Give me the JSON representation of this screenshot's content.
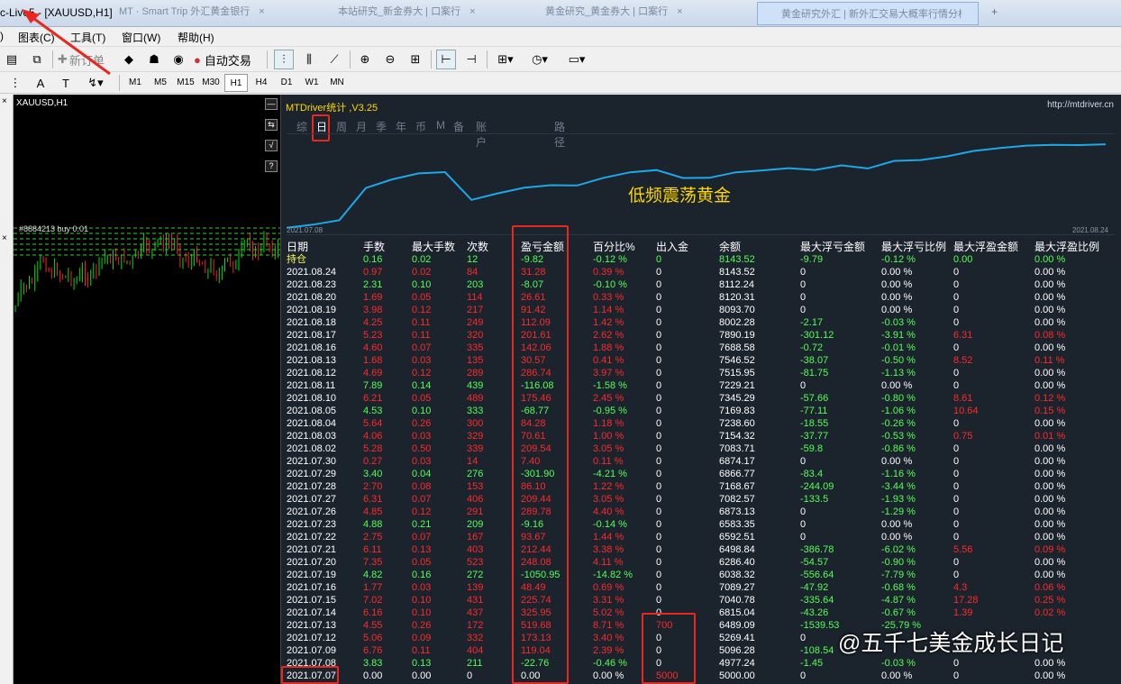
{
  "window": {
    "title": "c-Live5 - [XAUUSD,H1]",
    "tabs": [
      "MT · Smart Trip 外汇黄金银行",
      "本站研究_新金券大 | 口案行",
      "黄金研究_黄金券大 | 口案行"
    ],
    "active_tab": "黄金研究外汇 | 新外汇交易大概率行情分析",
    "new_tab": "+"
  },
  "menu": {
    "items": [
      "图表(C)",
      "工具(T)",
      "窗口(W)",
      "帮助(H)"
    ],
    "truncated_first": ")"
  },
  "toolbar": {
    "new_order": "新订单",
    "auto_trading": "自动交易",
    "text_tool": "A",
    "text_label_tool": "T"
  },
  "timeframes": [
    "M1",
    "M5",
    "M15",
    "M30",
    "H1",
    "H4",
    "D1",
    "W1",
    "MN"
  ],
  "active_timeframe": "H1",
  "chart": {
    "symbol_label": "XAUUSD,H1",
    "overlay_text": "#8884213 buy 0.01",
    "buttons": [
      "—",
      "⇆",
      "√",
      "?"
    ]
  },
  "panel": {
    "title": "MTDriver统计 ,V3.25",
    "url": "http://mtdriver.cn",
    "tabs": [
      "综",
      "日",
      "周",
      "月",
      "季",
      "年",
      "币",
      "M",
      "备",
      "账户",
      "路径"
    ],
    "selected_tab": "日",
    "graph_start": "2021.07.08",
    "graph_end": "2021.08.24",
    "graph_caption": "低频震荡黄金",
    "equity_curve": [
      4977,
      5096,
      5269,
      6489,
      6815,
      7040,
      7089,
      6038,
      6286,
      6498,
      6592,
      6583,
      6873,
      7082,
      7167,
      6866,
      6874,
      7083,
      7154,
      7238,
      7169,
      7345,
      7229,
      7515,
      7546,
      7688,
      7890,
      8002,
      8093,
      8120,
      8112,
      8143
    ]
  },
  "table": {
    "columns": [
      "日期",
      "手数",
      "最大手数",
      "次数",
      "盈亏金额",
      "百分比%",
      "出入金",
      "余额",
      "最大浮亏金额",
      "最大浮亏比例",
      "最大浮盈金额",
      "最大浮盈比例"
    ],
    "rows": [
      {
        "date": "持仓",
        "lots": "0.16",
        "max_lots": "0.02",
        "count": "12",
        "pnl": "-9.82",
        "pct": "-0.12 %",
        "io": "0",
        "balance": "8143.52",
        "mfl": "-9.79",
        "mflp": "-0.12 %",
        "mfp": "0.00",
        "mfpp": "0.00 %",
        "c": "g"
      },
      {
        "date": "2021.08.24",
        "lots": "0.97",
        "max_lots": "0.02",
        "count": "84",
        "pnl": "31.28",
        "pct": "0.39 %",
        "io": "0",
        "balance": "8143.52",
        "mfl": "0",
        "mflp": "0.00 %",
        "mfp": "0",
        "mfpp": "0.00 %",
        "c": "r"
      },
      {
        "date": "2021.08.23",
        "lots": "2.31",
        "max_lots": "0.10",
        "count": "203",
        "pnl": "-8.07",
        "pct": "-0.10 %",
        "io": "0",
        "balance": "8112.24",
        "mfl": "0",
        "mflp": "0.00 %",
        "mfp": "0",
        "mfpp": "0.00 %",
        "c": "g"
      },
      {
        "date": "2021.08.20",
        "lots": "1.69",
        "max_lots": "0.05",
        "count": "114",
        "pnl": "26.61",
        "pct": "0.33 %",
        "io": "0",
        "balance": "8120.31",
        "mfl": "0",
        "mflp": "0.00 %",
        "mfp": "0",
        "mfpp": "0.00 %",
        "c": "r"
      },
      {
        "date": "2021.08.19",
        "lots": "3.98",
        "max_lots": "0.12",
        "count": "217",
        "pnl": "91.42",
        "pct": "1.14 %",
        "io": "0",
        "balance": "8093.70",
        "mfl": "0",
        "mflp": "0.00 %",
        "mfp": "0",
        "mfpp": "0.00 %",
        "c": "r"
      },
      {
        "date": "2021.08.18",
        "lots": "4.25",
        "max_lots": "0.11",
        "count": "249",
        "pnl": "112.09",
        "pct": "1.42 %",
        "io": "0",
        "balance": "8002.28",
        "mfl": "-2.17",
        "mflp": "-0.03 %",
        "mfp": "0",
        "mfpp": "0.00 %",
        "c": "r"
      },
      {
        "date": "2021.08.17",
        "lots": "5.23",
        "max_lots": "0.11",
        "count": "320",
        "pnl": "201.61",
        "pct": "2.62 %",
        "io": "0",
        "balance": "7890.19",
        "mfl": "-301.12",
        "mflp": "-3.91 %",
        "mfp": "6.31",
        "mfpp": "0.08 %",
        "c": "r"
      },
      {
        "date": "2021.08.16",
        "lots": "4.60",
        "max_lots": "0.07",
        "count": "335",
        "pnl": "142.06",
        "pct": "1.88 %",
        "io": "0",
        "balance": "7688.58",
        "mfl": "-0.72",
        "mflp": "-0.01 %",
        "mfp": "0",
        "mfpp": "0.00 %",
        "c": "r"
      },
      {
        "date": "2021.08.13",
        "lots": "1.68",
        "max_lots": "0.03",
        "count": "135",
        "pnl": "30.57",
        "pct": "0.41 %",
        "io": "0",
        "balance": "7546.52",
        "mfl": "-38.07",
        "mflp": "-0.50 %",
        "mfp": "8.52",
        "mfpp": "0.11 %",
        "c": "r"
      },
      {
        "date": "2021.08.12",
        "lots": "4.69",
        "max_lots": "0.12",
        "count": "289",
        "pnl": "286.74",
        "pct": "3.97 %",
        "io": "0",
        "balance": "7515.95",
        "mfl": "-81.75",
        "mflp": "-1.13 %",
        "mfp": "0",
        "mfpp": "0.00 %",
        "c": "r"
      },
      {
        "date": "2021.08.11",
        "lots": "7.89",
        "max_lots": "0.14",
        "count": "439",
        "pnl": "-116.08",
        "pct": "-1.58 %",
        "io": "0",
        "balance": "7229.21",
        "mfl": "0",
        "mflp": "0.00 %",
        "mfp": "0",
        "mfpp": "0.00 %",
        "c": "g"
      },
      {
        "date": "2021.08.10",
        "lots": "6.21",
        "max_lots": "0.05",
        "count": "489",
        "pnl": "175.46",
        "pct": "2.45 %",
        "io": "0",
        "balance": "7345.29",
        "mfl": "-57.66",
        "mflp": "-0.80 %",
        "mfp": "8.61",
        "mfpp": "0.12 %",
        "c": "r"
      },
      {
        "date": "2021.08.05",
        "lots": "4.53",
        "max_lots": "0.10",
        "count": "333",
        "pnl": "-68.77",
        "pct": "-0.95 %",
        "io": "0",
        "balance": "7169.83",
        "mfl": "-77.11",
        "mflp": "-1.06 %",
        "mfp": "10.64",
        "mfpp": "0.15 %",
        "c": "g"
      },
      {
        "date": "2021.08.04",
        "lots": "5.64",
        "max_lots": "0.26",
        "count": "300",
        "pnl": "84.28",
        "pct": "1.18 %",
        "io": "0",
        "balance": "7238.60",
        "mfl": "-18.55",
        "mflp": "-0.26 %",
        "mfp": "0",
        "mfpp": "0.00 %",
        "c": "r"
      },
      {
        "date": "2021.08.03",
        "lots": "4.06",
        "max_lots": "0.03",
        "count": "329",
        "pnl": "70.61",
        "pct": "1.00 %",
        "io": "0",
        "balance": "7154.32",
        "mfl": "-37.77",
        "mflp": "-0.53 %",
        "mfp": "0.75",
        "mfpp": "0.01 %",
        "c": "r"
      },
      {
        "date": "2021.08.02",
        "lots": "5.28",
        "max_lots": "0.50",
        "count": "339",
        "pnl": "209.54",
        "pct": "3.05 %",
        "io": "0",
        "balance": "7083.71",
        "mfl": "-59.8",
        "mflp": "-0.86 %",
        "mfp": "0",
        "mfpp": "0.00 %",
        "c": "r"
      },
      {
        "date": "2021.07.30",
        "lots": "0.27",
        "max_lots": "0.03",
        "count": "14",
        "pnl": "7.40",
        "pct": "0.11 %",
        "io": "0",
        "balance": "6874.17",
        "mfl": "0",
        "mflp": "0.00 %",
        "mfp": "0",
        "mfpp": "0.00 %",
        "c": "r"
      },
      {
        "date": "2021.07.29",
        "lots": "3.40",
        "max_lots": "0.04",
        "count": "276",
        "pnl": "-301.90",
        "pct": "-4.21 %",
        "io": "0",
        "balance": "6866.77",
        "mfl": "-83.4",
        "mflp": "-1.16 %",
        "mfp": "0",
        "mfpp": "0.00 %",
        "c": "g"
      },
      {
        "date": "2021.07.28",
        "lots": "2.70",
        "max_lots": "0.08",
        "count": "153",
        "pnl": "86.10",
        "pct": "1.22 %",
        "io": "0",
        "balance": "7168.67",
        "mfl": "-244.09",
        "mflp": "-3.44 %",
        "mfp": "0",
        "mfpp": "0.00 %",
        "c": "r"
      },
      {
        "date": "2021.07.27",
        "lots": "6.31",
        "max_lots": "0.07",
        "count": "406",
        "pnl": "209.44",
        "pct": "3.05 %",
        "io": "0",
        "balance": "7082.57",
        "mfl": "-133.5",
        "mflp": "-1.93 %",
        "mfp": "0",
        "mfpp": "0.00 %",
        "c": "r"
      },
      {
        "date": "2021.07.26",
        "lots": "4.85",
        "max_lots": "0.12",
        "count": "291",
        "pnl": "289.78",
        "pct": "4.40 %",
        "io": "0",
        "balance": "6873.13",
        "mfl": "0",
        "mflp": "-1.29 %",
        "mfp": "0",
        "mfpp": "0.00 %",
        "c": "r"
      },
      {
        "date": "2021.07.23",
        "lots": "4.88",
        "max_lots": "0.21",
        "count": "209",
        "pnl": "-9.16",
        "pct": "-0.14 %",
        "io": "0",
        "balance": "6583.35",
        "mfl": "0",
        "mflp": "0.00 %",
        "mfp": "0",
        "mfpp": "0.00 %",
        "c": "g"
      },
      {
        "date": "2021.07.22",
        "lots": "2.75",
        "max_lots": "0.07",
        "count": "167",
        "pnl": "93.67",
        "pct": "1.44 %",
        "io": "0",
        "balance": "6592.51",
        "mfl": "0",
        "mflp": "0.00 %",
        "mfp": "0",
        "mfpp": "0.00 %",
        "c": "r"
      },
      {
        "date": "2021.07.21",
        "lots": "6.11",
        "max_lots": "0.13",
        "count": "403",
        "pnl": "212.44",
        "pct": "3.38 %",
        "io": "0",
        "balance": "6498.84",
        "mfl": "-386.78",
        "mflp": "-6.02 %",
        "mfp": "5.56",
        "mfpp": "0.09 %",
        "c": "r"
      },
      {
        "date": "2021.07.20",
        "lots": "7.35",
        "max_lots": "0.05",
        "count": "523",
        "pnl": "248.08",
        "pct": "4.11 %",
        "io": "0",
        "balance": "6286.40",
        "mfl": "-54.57",
        "mflp": "-0.90 %",
        "mfp": "0",
        "mfpp": "0.00 %",
        "c": "r"
      },
      {
        "date": "2021.07.19",
        "lots": "4.82",
        "max_lots": "0.16",
        "count": "272",
        "pnl": "-1050.95",
        "pct": "-14.82 %",
        "io": "0",
        "balance": "6038.32",
        "mfl": "-556.64",
        "mflp": "-7.79 %",
        "mfp": "0",
        "mfpp": "0.00 %",
        "c": "g"
      },
      {
        "date": "2021.07.16",
        "lots": "1.77",
        "max_lots": "0.03",
        "count": "139",
        "pnl": "48.49",
        "pct": "0.69 %",
        "io": "0",
        "balance": "7089.27",
        "mfl": "-47.92",
        "mflp": "-0.68 %",
        "mfp": "4.3",
        "mfpp": "0.06 %",
        "c": "r"
      },
      {
        "date": "2021.07.15",
        "lots": "7.02",
        "max_lots": "0.10",
        "count": "431",
        "pnl": "225.74",
        "pct": "3.31 %",
        "io": "0",
        "balance": "7040.78",
        "mfl": "-335.64",
        "mflp": "-4.87 %",
        "mfp": "17.28",
        "mfpp": "0.25 %",
        "c": "r"
      },
      {
        "date": "2021.07.14",
        "lots": "6.16",
        "max_lots": "0.10",
        "count": "437",
        "pnl": "325.95",
        "pct": "5.02 %",
        "io": "0",
        "balance": "6815.04",
        "mfl": "-43.26",
        "mflp": "-0.67 %",
        "mfp": "1.39",
        "mfpp": "0.02 %",
        "c": "r"
      },
      {
        "date": "2021.07.13",
        "lots": "4.55",
        "max_lots": "0.26",
        "count": "172",
        "pnl": "519.68",
        "pct": "8.71 %",
        "io": "700",
        "balance": "6489.09",
        "mfl": "-1539.53",
        "mflp": "-25.79 %",
        "mfp": "",
        "mfpp": "",
        "c": "r"
      },
      {
        "date": "2021.07.12",
        "lots": "5.06",
        "max_lots": "0.09",
        "count": "332",
        "pnl": "173.13",
        "pct": "3.40 %",
        "io": "0",
        "balance": "5269.41",
        "mfl": "0",
        "mflp": "",
        "mfp": "",
        "mfpp": "",
        "c": "r"
      },
      {
        "date": "2021.07.09",
        "lots": "6.76",
        "max_lots": "0.11",
        "count": "404",
        "pnl": "119.04",
        "pct": "2.39 %",
        "io": "0",
        "balance": "5096.28",
        "mfl": "-108.54",
        "mflp": "",
        "mfp": "",
        "mfpp": "",
        "c": "r"
      },
      {
        "date": "2021.07.08",
        "lots": "3.83",
        "max_lots": "0.13",
        "count": "211",
        "pnl": "-22.76",
        "pct": "-0.46 %",
        "io": "0",
        "balance": "4977.24",
        "mfl": "-1.45",
        "mflp": "-0.03 %",
        "mfp": "0",
        "mfpp": "0.00 %",
        "c": "g"
      },
      {
        "date": "2021.07.07",
        "lots": "0.00",
        "max_lots": "0.00",
        "count": "0",
        "pnl": "0.00",
        "pct": "0.00 %",
        "io": "5000",
        "balance": "5000.00",
        "mfl": "0",
        "mflp": "0.00 %",
        "mfp": "0",
        "mfpp": "0.00 %",
        "c": "w"
      }
    ]
  },
  "watermark": "@五千七美金成长日记",
  "colors": {
    "profit_red": "#ff2a2a",
    "loss_green": "#55ff55",
    "panel_bg": "#1b232d",
    "curve": "#1ea8e8",
    "highlight_box": "#e8281e",
    "title_yellow": "#ffd700"
  }
}
